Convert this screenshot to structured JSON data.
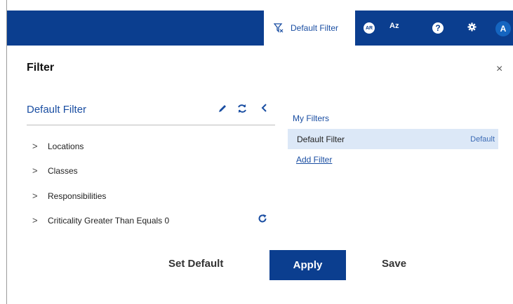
{
  "topbar": {
    "filter_label": "Default Filter",
    "ar_label": "AR",
    "az_label": "Az",
    "help_label": "?",
    "avatar_initial": "A",
    "bg_color": "#0b3e8f"
  },
  "dialog": {
    "title": "Filter",
    "close_label": "×"
  },
  "current_filter": {
    "name": "Default Filter",
    "tree": [
      {
        "label": "Locations"
      },
      {
        "label": "Classes"
      },
      {
        "label": "Responsibilities"
      },
      {
        "label": "Criticality Greater Than Equals 0"
      }
    ]
  },
  "my_filters": {
    "heading": "My Filters",
    "items": [
      {
        "name": "Default Filter",
        "badge": "Default"
      }
    ],
    "add_label": "Add Filter"
  },
  "actions": {
    "set_default": "Set Default",
    "apply": "Apply",
    "save": "Save"
  }
}
